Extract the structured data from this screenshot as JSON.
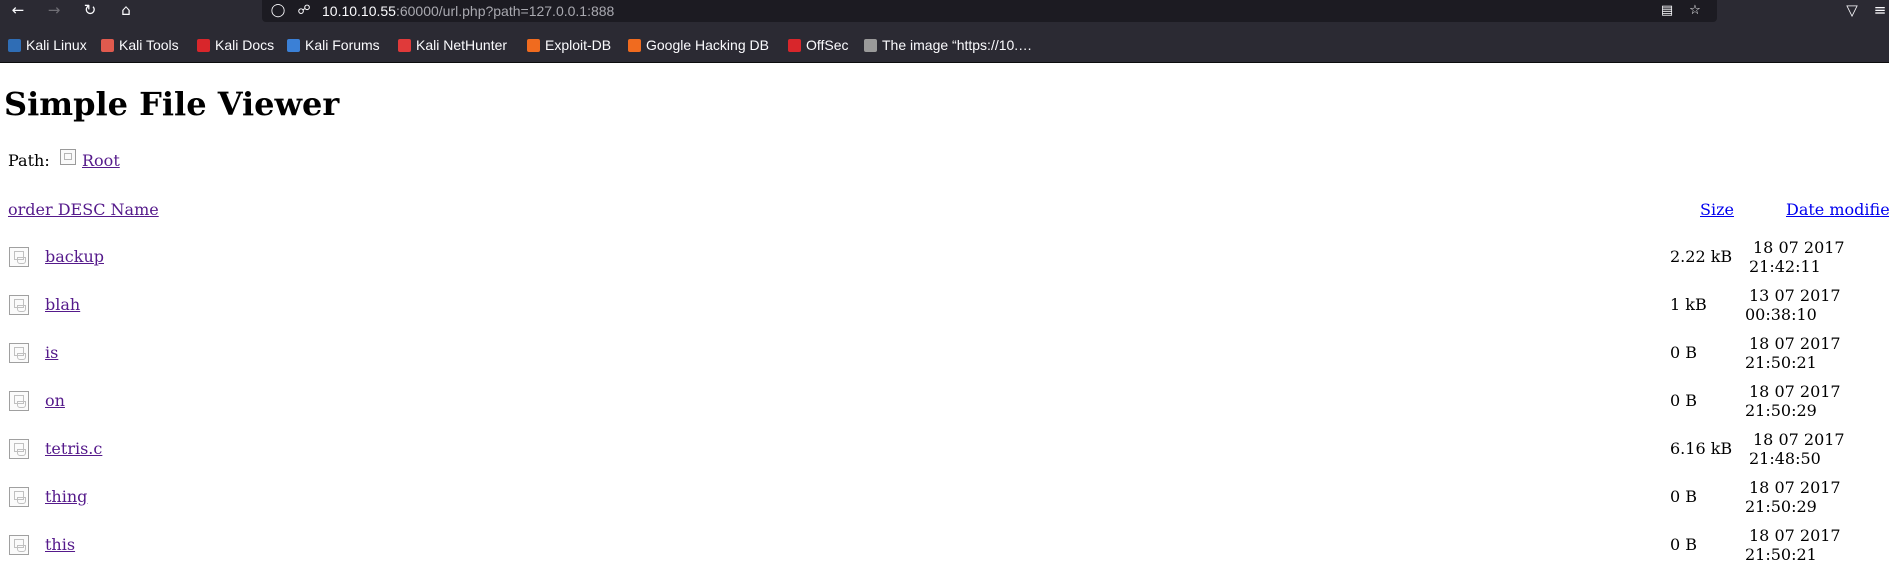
{
  "browser": {
    "url_host": "10.10.10.55",
    "url_rest": ":60000/url.php?path=127.0.0.1:888",
    "bookmarks": [
      {
        "label": "Kali Linux",
        "color": "#2f6db5"
      },
      {
        "label": "Kali Tools",
        "color": "#e05a4e"
      },
      {
        "label": "Kali Docs",
        "color": "#d8262b"
      },
      {
        "label": "Kali Forums",
        "color": "#3b80d6"
      },
      {
        "label": "Kali NetHunter",
        "color": "#e03a3a"
      },
      {
        "label": "Exploit-DB",
        "color": "#f06b1f"
      },
      {
        "label": "Google Hacking DB",
        "color": "#f06b1f"
      },
      {
        "label": "OffSec",
        "color": "#d8262b"
      },
      {
        "label": "The image “https://10.…",
        "color": "#9a9a9a"
      }
    ]
  },
  "page": {
    "title": "Simple File Viewer",
    "path_label": "Path:",
    "path_root": "Root",
    "headers": {
      "name": "order DESC Name",
      "size": "Size",
      "date": "Date modifie"
    },
    "files": [
      {
        "name": "backup",
        "size": "2.22 kB",
        "date_line1": "18 07 2017",
        "date_line2": "21:42:11"
      },
      {
        "name": "blah",
        "size": "1 kB",
        "date_line1": "13 07 2017",
        "date_line2": "00:38:10"
      },
      {
        "name": "is",
        "size": "0 B",
        "date_line1": "18 07 2017",
        "date_line2": "21:50:21"
      },
      {
        "name": "on",
        "size": "0 B",
        "date_line1": "18 07 2017",
        "date_line2": "21:50:29"
      },
      {
        "name": "tetris.c",
        "size": "6.16 kB",
        "date_line1": "18 07 2017",
        "date_line2": "21:48:50"
      },
      {
        "name": "thing",
        "size": "0 B",
        "date_line1": "18 07 2017",
        "date_line2": "21:50:29"
      },
      {
        "name": "this",
        "size": "0 B",
        "date_line1": "18 07 2017",
        "date_line2": "21:50:21"
      }
    ]
  }
}
